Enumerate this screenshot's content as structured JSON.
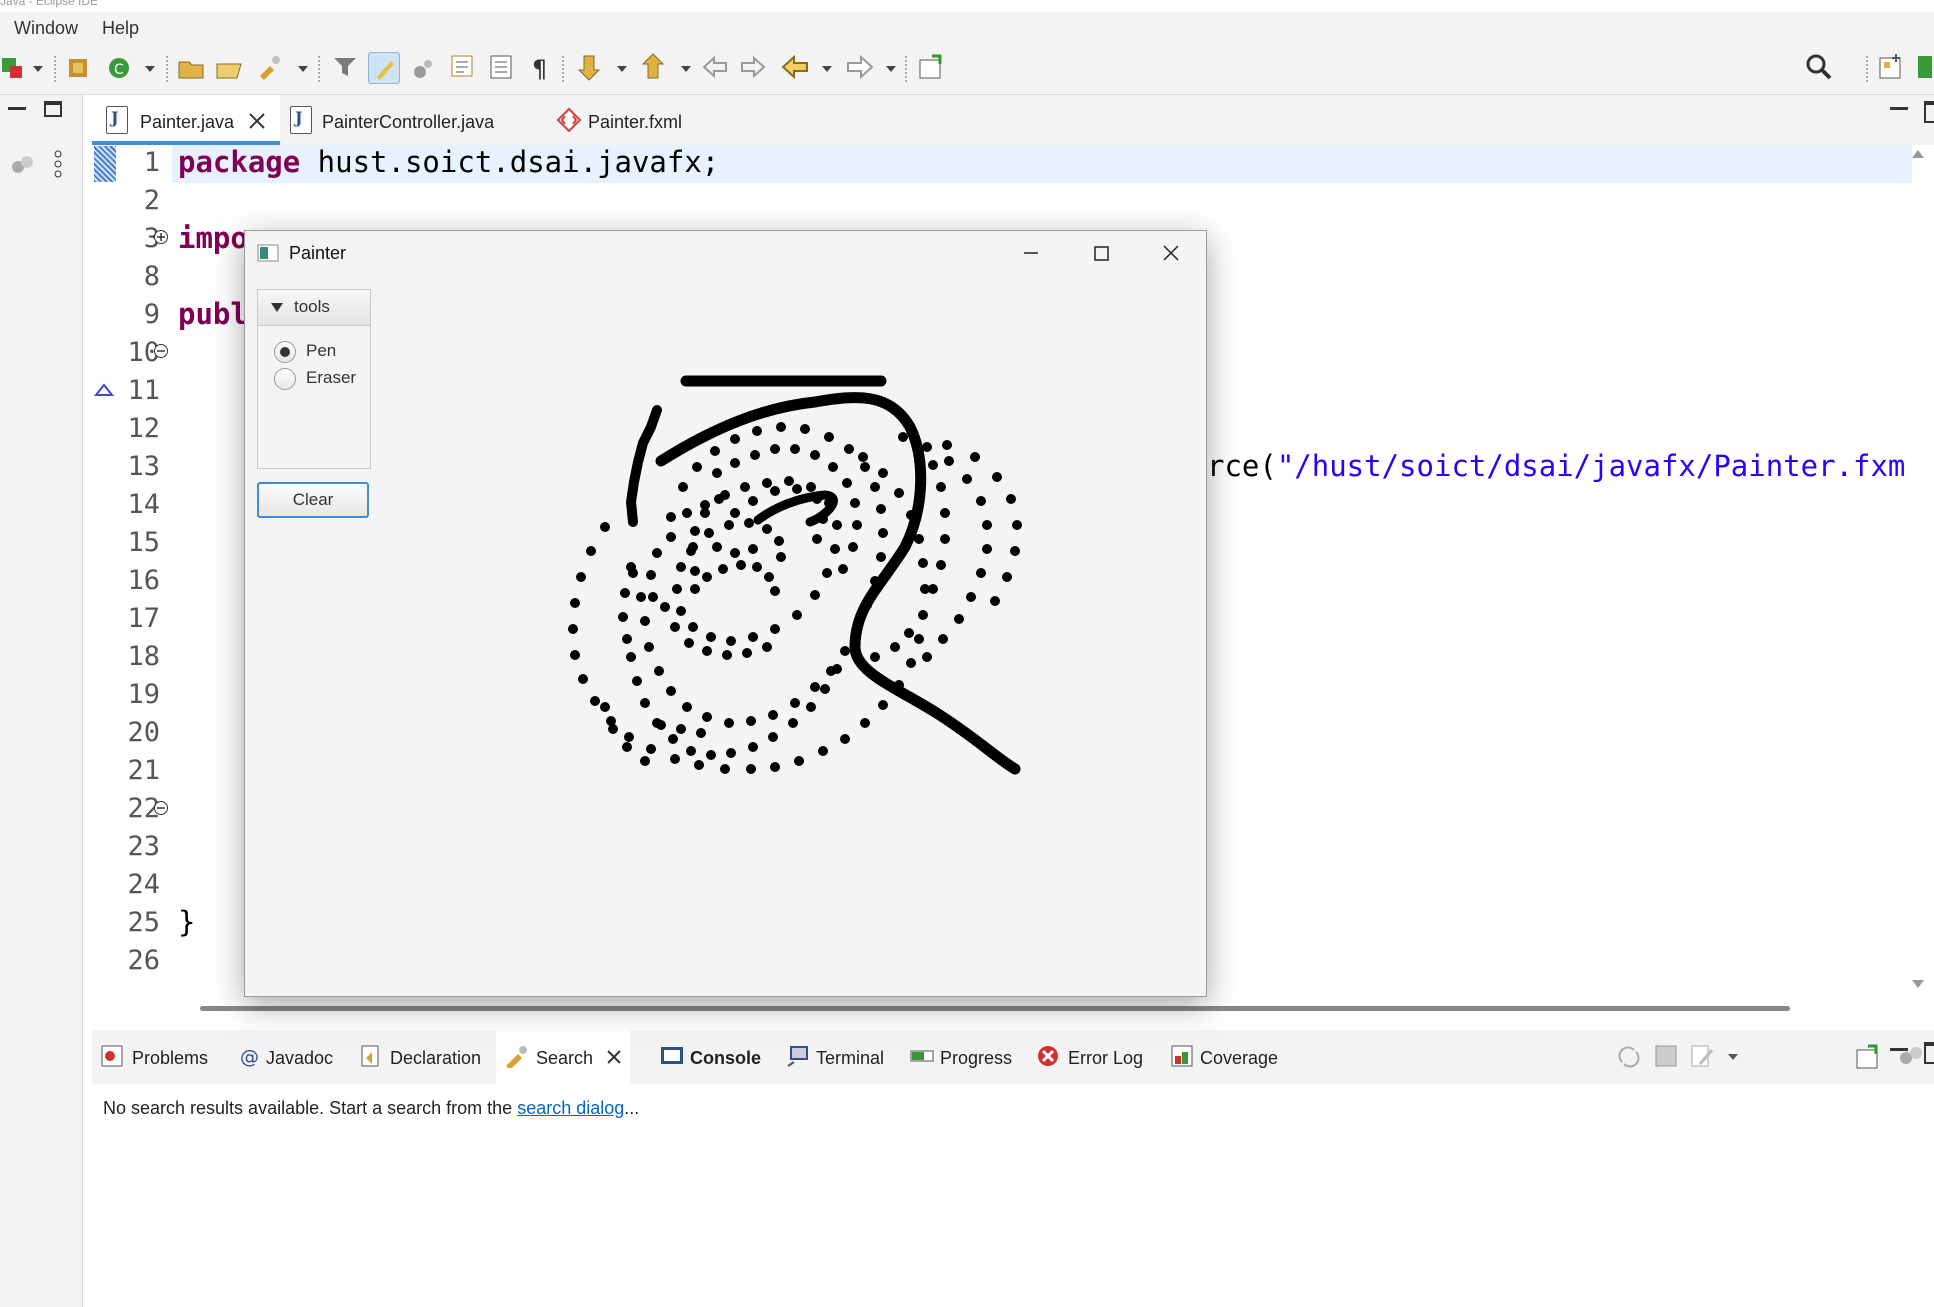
{
  "window_title": "Java - Eclipse IDE",
  "menu": [
    "Window",
    "Help"
  ],
  "editor_tabs": [
    {
      "label": "Painter.java",
      "active": true,
      "closable": true
    },
    {
      "label": "PainterController.java",
      "active": false
    },
    {
      "label": "Painter.fxml",
      "active": false
    }
  ],
  "editor": {
    "line_numbers": [
      "1",
      "2",
      "3",
      "8",
      "9",
      "10",
      "11",
      "12",
      "13",
      "14",
      "15",
      "16",
      "17",
      "18",
      "19",
      "20",
      "21",
      "22",
      "23",
      "24",
      "25",
      "26"
    ],
    "line1_keyword": "package",
    "line1_rest": " hust.soict.dsai.javafx;",
    "line3_visible": "impo",
    "line9_visible": "publ",
    "line13_tail_prefix": "rce(",
    "line13_tail_string": "\"/hust/soict/dsai/javafx/Painter.fxm",
    "line25_text": "}"
  },
  "painter_window": {
    "title": "Painter",
    "tools_pane_title": "tools",
    "radio_pen": "Pen",
    "radio_eraser": "Eraser",
    "selected_tool": "Pen",
    "clear_button": "Clear"
  },
  "bottom_tabs": [
    {
      "label": "Problems",
      "icon": "problems-icon"
    },
    {
      "label": "Javadoc",
      "icon": "javadoc-icon"
    },
    {
      "label": "Declaration",
      "icon": "declaration-icon"
    },
    {
      "label": "Search",
      "icon": "search-icon",
      "closable": true
    },
    {
      "label": "Console",
      "icon": "console-icon",
      "bold": true
    },
    {
      "label": "Terminal",
      "icon": "terminal-icon"
    },
    {
      "label": "Progress",
      "icon": "progress-icon"
    },
    {
      "label": "Error Log",
      "icon": "error-log-icon"
    },
    {
      "label": "Coverage",
      "icon": "coverage-icon"
    }
  ],
  "search_message": {
    "text": "No search results available. Start a search from the ",
    "link": "search dialog",
    "suffix": "..."
  },
  "colors": {
    "keyword": "#7f0055",
    "string": "#2a00ff",
    "current_line": "#e8f2fe",
    "link": "#0563c1",
    "focus": "#3c8fd8"
  }
}
